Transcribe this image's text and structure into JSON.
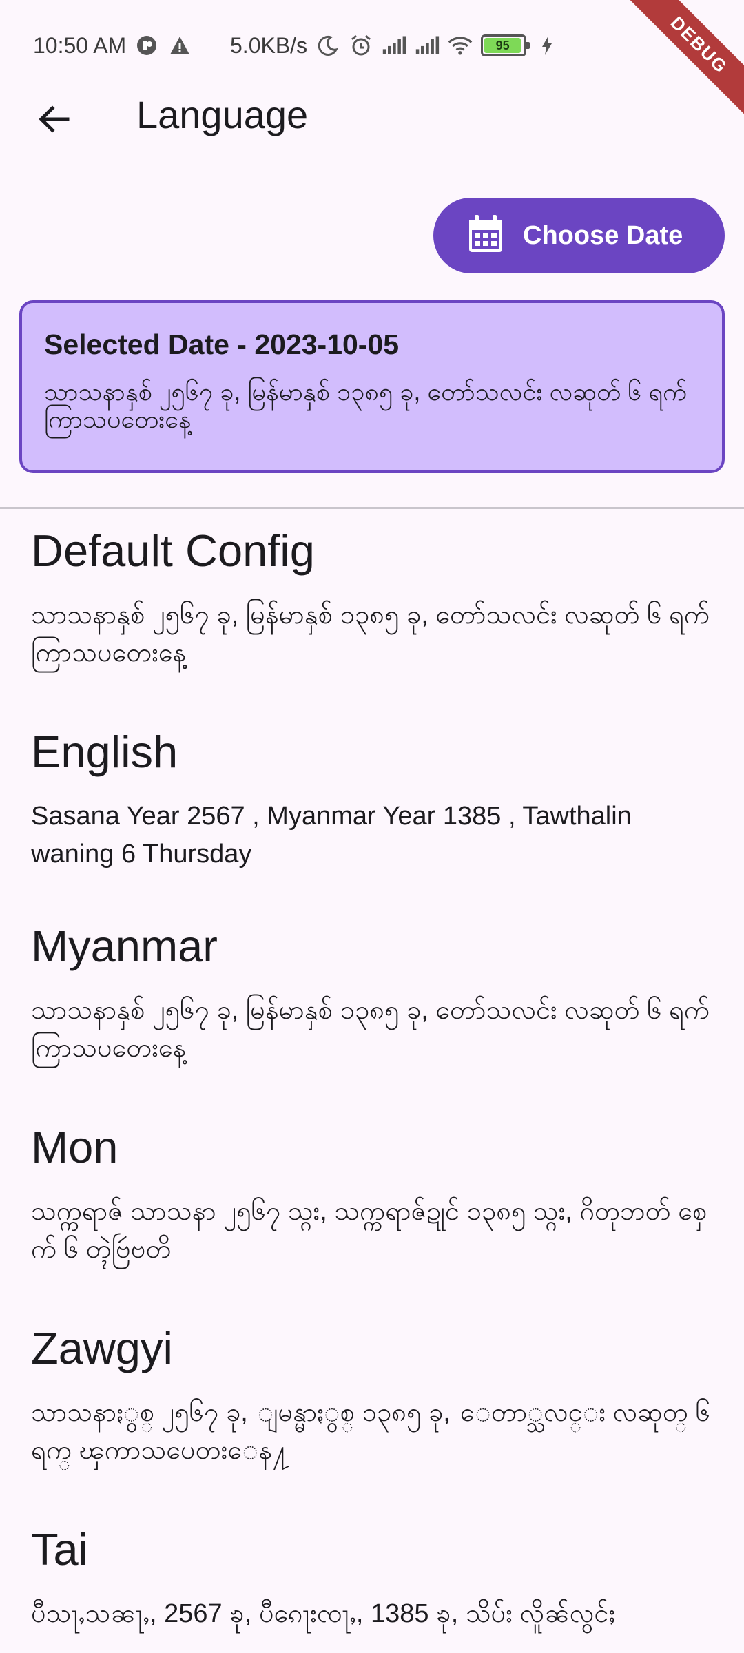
{
  "status_bar": {
    "time": "10:50 AM",
    "net_speed": "5.0KB/s",
    "battery_level": "95",
    "icons": [
      "app-notification-icon",
      "warning-icon",
      "moon-icon",
      "alarm-icon",
      "signal-icon",
      "signal-icon",
      "wifi-icon",
      "battery-icon",
      "charging-icon"
    ]
  },
  "debug_banner": "DEBUG",
  "app_bar": {
    "title": "Language",
    "back_icon": "arrow-back-icon"
  },
  "choose_date": {
    "label": "Choose Date",
    "icon": "calendar-icon"
  },
  "selected_card": {
    "title": "Selected Date - 2023-10-05",
    "text": "သာသနာနှစ် ၂၅၆၇ ခု, မြန်မာနှစ် ၁၃၈၅ ခု, တော်သလင်း လဆုတ် ၆ ရက် ကြာသပတေးနေ့"
  },
  "languages": [
    {
      "heading": "Default Config",
      "text": "သာသနာနှစ် ၂၅၆၇ ခု, မြန်မာနှစ် ၁၃၈၅ ခု, တော်သလင်း လဆုတ် ၆ ရက် ကြာသပတေးနေ့"
    },
    {
      "heading": "English",
      "text": "Sasana Year 2567 , Myanmar Year 1385 , Tawthalin waning 6  Thursday"
    },
    {
      "heading": "Myanmar",
      "text": "သာသနာနှစ် ၂၅၆၇ ခု, မြန်မာနှစ် ၁၃၈၅ ခု, တော်သလင်း လဆုတ် ၆ ရက် ကြာသပတေးနေ့"
    },
    {
      "heading": "Mon",
      "text": "သက္ကရာဇ် သာသနာ ၂၅၆၇ သ္ဂး, သက္ကရာဇ်ဍုင် ၁၃၈၅ သ္ဂး, ဂိတုဘတ် စှေက် ၆  တ္ၚဲဗြဴဗတိ"
    },
    {
      "heading": "Zawgyi",
      "text": "သာသနာႏွစ္ ၂၅၆၇ ခု, ျမန္မာႏွစ္ ၁၃၈၅ ခု, ေတာ္သလင္း လဆုတ္ ၆ ရက္ ၾကာသပေတးေန႔"
    },
    {
      "heading": "Tai",
      "text": "ပီသႃႇသၼႃႇ, 2567 ၶု, ပီၵေႃးၸႃႇ, 1385 ၶု, သိပ်း လိူၼ်လွင်ႈ"
    }
  ]
}
